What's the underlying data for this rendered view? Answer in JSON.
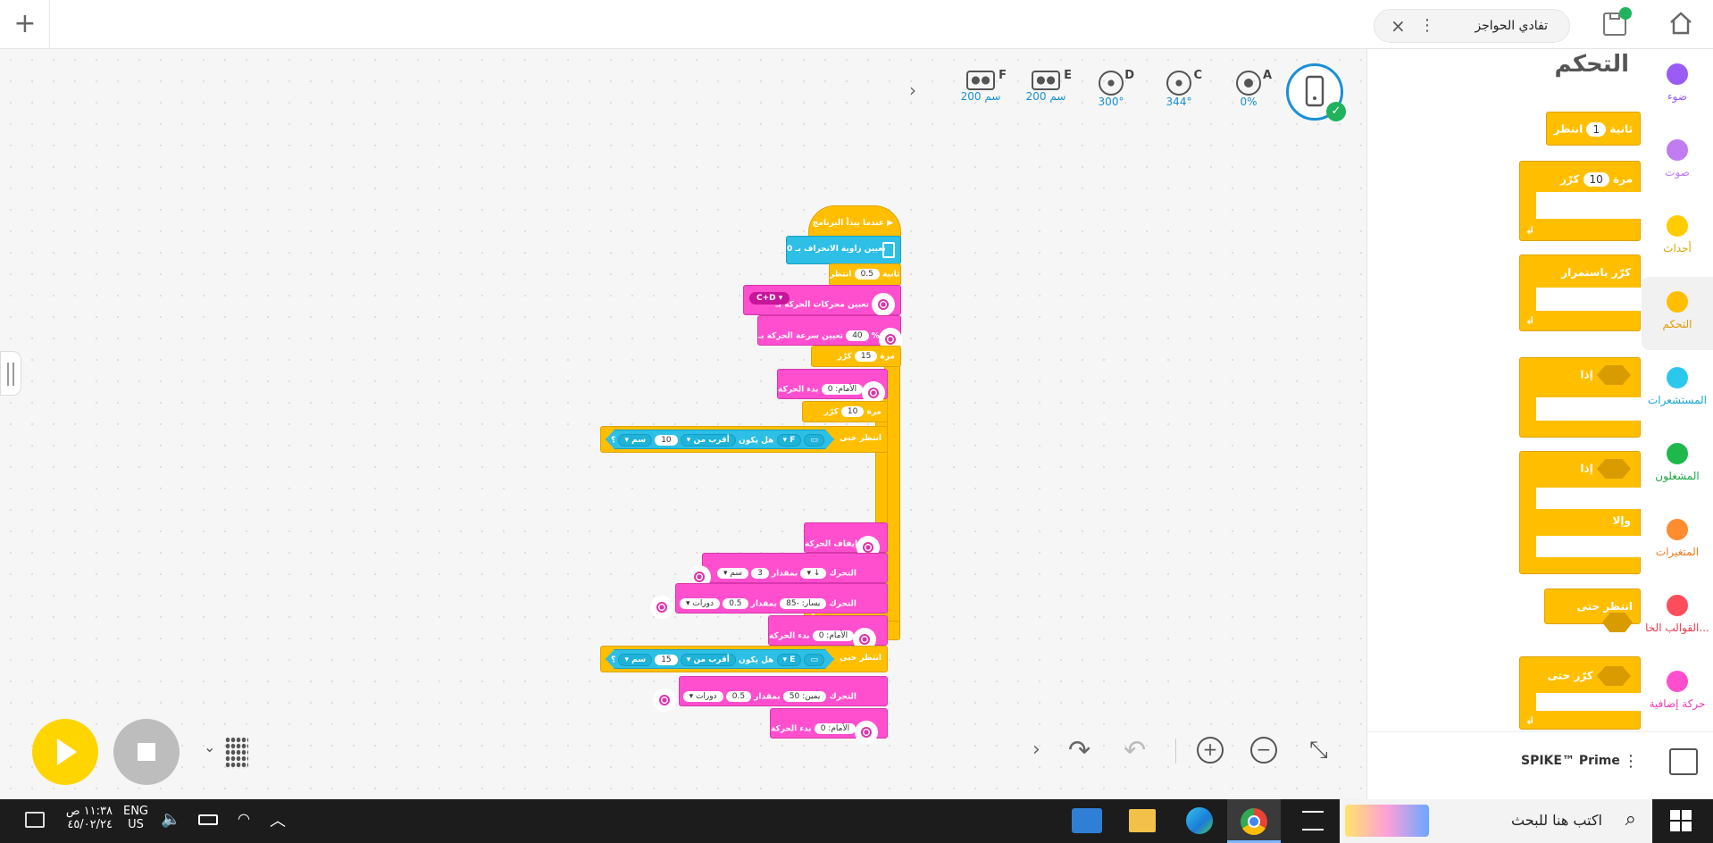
{
  "topbar": {
    "tab_title": "تفادي الحواجز",
    "new_tab": "+",
    "close": "×",
    "more": "⋮"
  },
  "hub": {
    "ports": [
      {
        "letter": "A",
        "value": "0%"
      },
      {
        "letter": "C",
        "value": "344°"
      },
      {
        "letter": "D",
        "value": "300°"
      },
      {
        "letter": "E",
        "value": "200 سم"
      },
      {
        "letter": "F",
        "value": "200 سم"
      }
    ]
  },
  "sidebar": {
    "title": "التحكم",
    "categories": [
      {
        "label": "ضوء",
        "color": "#9a5cf4"
      },
      {
        "label": "صوت",
        "color": "#c07cf0"
      },
      {
        "label": "أحداث",
        "color": "#ffcc00"
      },
      {
        "label": "التحكم",
        "color": "#ffbf00"
      },
      {
        "label": "المستشعرات",
        "color": "#2bc8ee"
      },
      {
        "label": "المشغلون",
        "color": "#1fb84c"
      },
      {
        "label": "المتغيرات",
        "color": "#ff8c2e"
      },
      {
        "label": "القوالب الخا...",
        "color": "#ff4d5b"
      },
      {
        "label": "حركة إضافية",
        "color": "#ff4fcf"
      }
    ],
    "palette": {
      "wait_label": "انتظر",
      "wait_value": "1",
      "wait_unit": "ثانية",
      "repeat_label": "كرّر",
      "repeat_value": "10",
      "repeat_unit": "مرة",
      "forever_label": "كرّر باستمرار",
      "if_label": "إذا",
      "if_else_label": "إذا",
      "else_label": "وإلا",
      "wait_until_label": "انتظر حتى",
      "repeat_until_label": "كرّر حتى"
    },
    "footer": {
      "product": "SPIKE™ Prime"
    }
  },
  "program": {
    "start": "عندما يبدأ البرنامج",
    "set_yaw": "تعيين زاوية الانحراف بـ 0",
    "wait1": {
      "label": "انتظر",
      "value": "0.5",
      "unit": "ثانية"
    },
    "set_pair": {
      "label": "تعيين محركات الحركة بـ",
      "value": "C+D"
    },
    "set_speed": {
      "label": "تعيين سرعة الحركة بـ",
      "value": "40",
      "unit": "%"
    },
    "repeat1": {
      "label": "كرّر",
      "value": "15",
      "unit": "مرة"
    },
    "start_move1": {
      "label": "بدء الحركة",
      "value": "الأمام: 0"
    },
    "repeat2": {
      "label": "كرّر",
      "value": "10",
      "unit": "مرة"
    },
    "wait_until1": {
      "label": "انتظر حتى",
      "port": "F",
      "q": "هل يكون",
      "cmp": "أقرب من",
      "value": "10",
      "unit": "سم",
      "end": "؟"
    },
    "stop_move": {
      "label": "إيقاف الحركة"
    },
    "move1": {
      "label": "التحرك",
      "dir": "↓",
      "by": "بمقدار",
      "value": "3",
      "unit": "سم"
    },
    "move2": {
      "label": "التحرك",
      "steer": "يسار: -85",
      "by": "بمقدار",
      "value": "0.5",
      "unit": "دورات"
    },
    "start_move2": {
      "label": "بدء الحركة",
      "value": "الأمام: 0"
    },
    "wait_until2": {
      "label": "انتظر حتى",
      "port": "E",
      "q": "هل يكون",
      "cmp": "أقرب من",
      "value": "15",
      "unit": "سم",
      "end": "؟"
    },
    "move3": {
      "label": "التحرك",
      "steer": "يمين: 50",
      "by": "بمقدار",
      "value": "0.5",
      "unit": "دورات"
    },
    "start_move3": {
      "label": "بدء الحركة",
      "value": "الأمام: 0"
    }
  },
  "taskbar": {
    "search": "اكتب هنا للبحث",
    "time": "١١:٣٨ ص",
    "date": "٤٥/٠٢/٢٤",
    "lang": "ENG",
    "region": "US"
  }
}
